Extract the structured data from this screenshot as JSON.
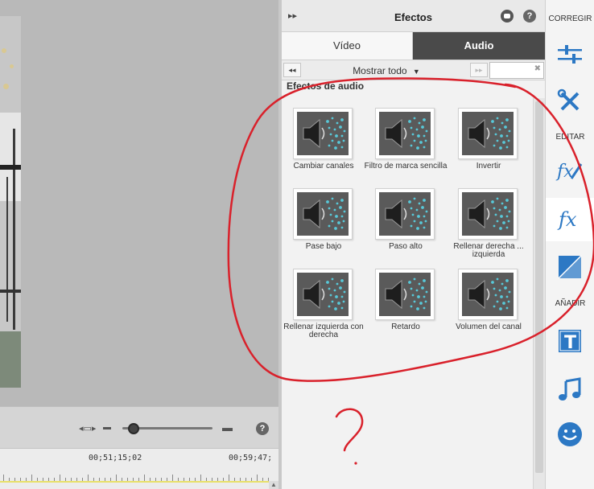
{
  "preview": {
    "timeline": {
      "timecode_1": "00;51;15;02",
      "timecode_2": "00;59;47;"
    },
    "help_label": "?"
  },
  "effects_panel": {
    "title": "Efectos",
    "help_label": "?",
    "tabs": [
      {
        "label": "Vídeo",
        "active": false
      },
      {
        "label": "Audio",
        "active": true
      }
    ],
    "toolbar": {
      "filter_label": "Mostrar todo",
      "search_value": ""
    },
    "section_title": "Efectos de audio",
    "effects": [
      {
        "label": "Cambiar canales"
      },
      {
        "label": "Filtro de marca sencilla"
      },
      {
        "label": "Invertir"
      },
      {
        "label": "Pase bajo"
      },
      {
        "label": "Paso alto"
      },
      {
        "label": "Rellenar derecha ... izquierda"
      },
      {
        "label": "Rellenar izquierda con derecha"
      },
      {
        "label": "Retardo"
      },
      {
        "label": "Volumen del canal"
      }
    ],
    "icons": {
      "effect_icon": "speaker-icon"
    }
  },
  "right_toolbar": {
    "sections": [
      {
        "label": "CORREGIR"
      },
      {
        "label": "EDITAR"
      },
      {
        "label": "AÑADIR"
      }
    ]
  },
  "colors": {
    "accent_dark": "#4a4a4a",
    "annotation": "#d9212b",
    "dot_teal": "#58c8d8",
    "icon_blue": "#2c78c4"
  }
}
